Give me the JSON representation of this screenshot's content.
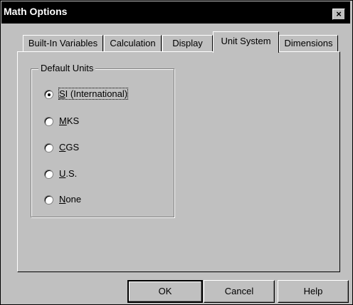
{
  "window": {
    "title": "Math Options",
    "close_glyph": "×"
  },
  "tabs": [
    {
      "label": "Built-In Variables",
      "active": false
    },
    {
      "label": "Calculation",
      "active": false
    },
    {
      "label": "Display",
      "active": false
    },
    {
      "label": "Unit System",
      "active": true
    },
    {
      "label": "Dimensions",
      "active": false
    }
  ],
  "group": {
    "label": "Default Units",
    "options": [
      {
        "mnemonic": "S",
        "rest": "I (International)",
        "selected": true
      },
      {
        "mnemonic": "M",
        "rest": "KS",
        "selected": false
      },
      {
        "mnemonic": "C",
        "rest": "GS",
        "selected": false
      },
      {
        "mnemonic": "U",
        "rest": ".S.",
        "selected": false
      },
      {
        "mnemonic": "N",
        "rest": "one",
        "selected": false
      }
    ]
  },
  "buttons": {
    "ok": "OK",
    "cancel": "Cancel",
    "help": "Help"
  }
}
